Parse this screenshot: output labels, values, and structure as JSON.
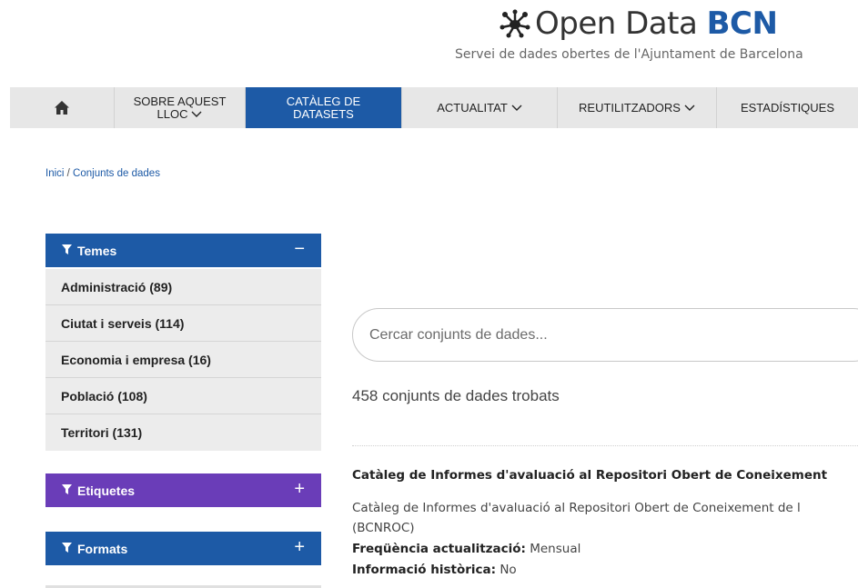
{
  "header": {
    "logo_text": "Open Data",
    "logo_bold": "BCN",
    "tagline": "Servei de dades obertes de l'Ajuntament de Barcelona"
  },
  "nav": {
    "home_icon": "home-icon",
    "about_line1": "SOBRE AQUEST",
    "about_line2": "LLOC",
    "catalog_line1": "CATÀLEG DE",
    "catalog_line2": "DATASETS",
    "news": "ACTUALITAT",
    "reusers": "REUTILITZADORS",
    "stats": "ESTADÍSTIQUES"
  },
  "breadcrumb": {
    "home": "Inici",
    "separator": " / ",
    "current": "Conjunts de dades"
  },
  "sidebar": {
    "themes": {
      "label": "Temes",
      "toggle": "−",
      "items": [
        {
          "label": "Administració (89)"
        },
        {
          "label": "Ciutat i serveis (114)"
        },
        {
          "label": "Economia i empresa (16)"
        },
        {
          "label": "Població (108)"
        },
        {
          "label": "Territori (131)"
        }
      ]
    },
    "tags": {
      "label": "Etiquetes",
      "toggle": "+"
    },
    "formats": {
      "label": "Formats",
      "toggle": "+"
    }
  },
  "colors": {
    "brand_blue": "#1d5aa6",
    "tags_purple": "#6a3db8"
  },
  "search": {
    "placeholder": "Cercar conjunts de dades..."
  },
  "results": {
    "count_text": "458 conjunts de dades trobats",
    "items": [
      {
        "title": "Catàleg de Informes d'avaluació al Repositori Obert de Coneixement",
        "description": "Catàleg de Informes d'avaluació al Repositori Obert de Coneixement de l",
        "description_line2": "(BCNROC)",
        "frequency_label": "Freqüència actualització:",
        "frequency_value": "Mensual",
        "history_label": "Informació històrica:",
        "history_value": "No"
      }
    ]
  }
}
